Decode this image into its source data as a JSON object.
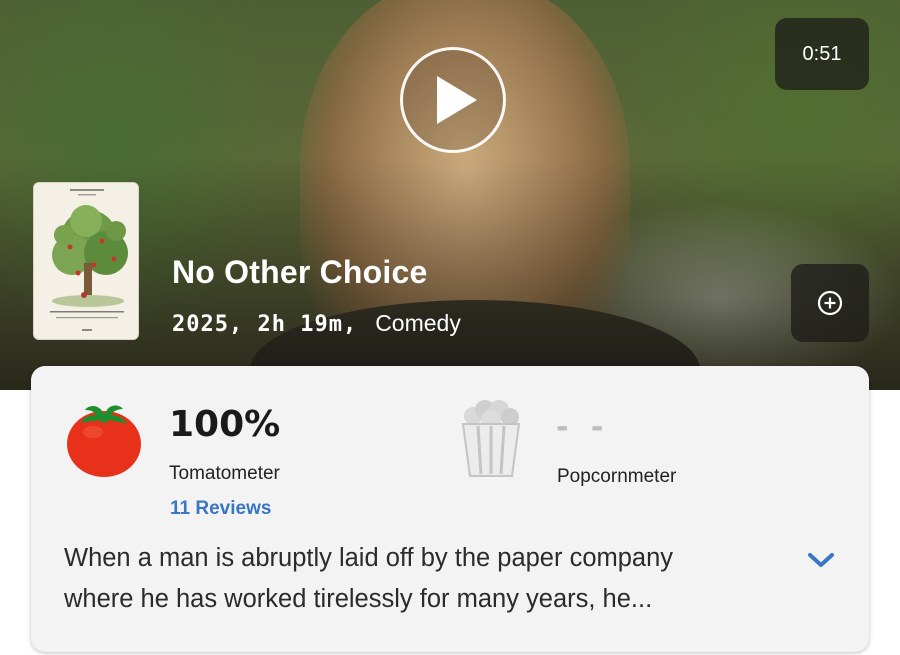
{
  "video": {
    "duration": "0:51",
    "play_icon": "play-icon",
    "add_icon": "plus-circle-icon"
  },
  "movie": {
    "title": "No Other Choice",
    "year_duration": "2025, 2h 19m,",
    "genre": "Comedy",
    "poster_title": "NO OTHER CHOICE"
  },
  "scores": {
    "tomatometer": {
      "value": "100%",
      "label": "Tomatometer",
      "reviews": "11 Reviews",
      "icon": "tomato-icon"
    },
    "popcornmeter": {
      "value": "- -",
      "label": "Popcornmeter",
      "icon": "popcorn-icon"
    }
  },
  "synopsis": {
    "line1": "When a man is abruptly laid off by the paper company",
    "line2": "where he has worked tirelessly for many years, he...",
    "expand_icon": "chevron-down-icon"
  },
  "colors": {
    "link": "#3a76c4",
    "tomato": "#e8311a",
    "card": "#f3f3f3"
  }
}
